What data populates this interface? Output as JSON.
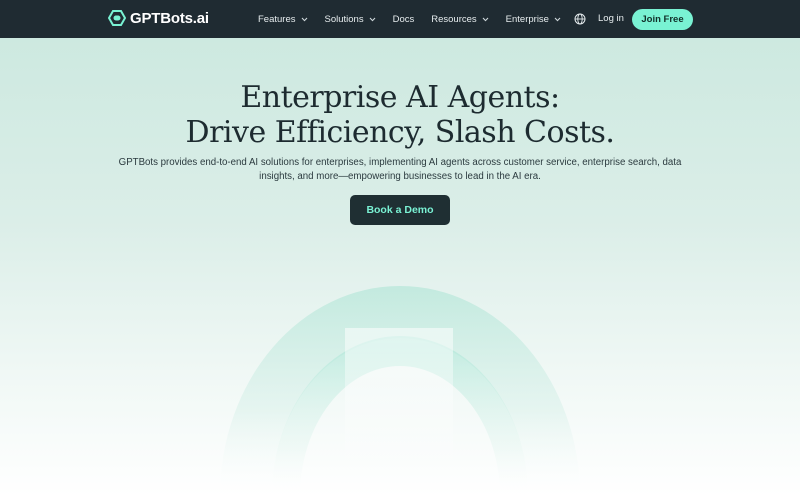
{
  "nav": {
    "logo_text": "GPTBots.ai",
    "items": [
      {
        "label": "Features",
        "has_dropdown": true
      },
      {
        "label": "Solutions",
        "has_dropdown": true
      },
      {
        "label": "Docs",
        "has_dropdown": false
      },
      {
        "label": "Resources",
        "has_dropdown": true
      },
      {
        "label": "Enterprise",
        "has_dropdown": true
      }
    ],
    "language_icon": "globe-icon",
    "login_label": "Log in",
    "join_label": "Join Free"
  },
  "hero": {
    "title_line1": "Enterprise AI Agents:",
    "title_line2": "Drive Efficiency, Slash Costs.",
    "subtitle_line1": "GPTBots provides end-to-end AI solutions for enterprises, implementing AI agents across customer service, enterprise search, data",
    "subtitle_line2": "insights, and more—empowering businesses to lead in the AI era.",
    "cta_label": "Book a Demo"
  },
  "colors": {
    "nav_bg": "#1f2b32",
    "accent": "#79f2d3",
    "cta_bg": "#1f2f33",
    "hero_top": "#cde9e0"
  }
}
